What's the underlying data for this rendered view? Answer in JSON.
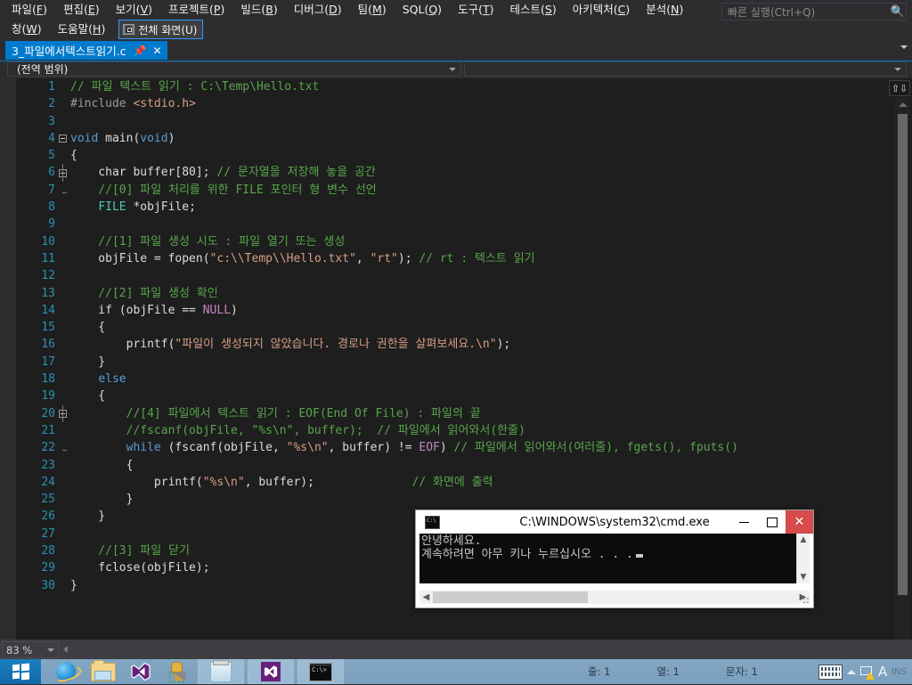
{
  "menu": {
    "row1": [
      {
        "label": "파일(F)",
        "mnemonic": "F"
      },
      {
        "label": "편집(E)",
        "mnemonic": "E"
      },
      {
        "label": "보기(V)",
        "mnemonic": "V"
      },
      {
        "label": "프로젝트(P)",
        "mnemonic": "P"
      },
      {
        "label": "빌드(B)",
        "mnemonic": "B"
      },
      {
        "label": "디버그(D)",
        "mnemonic": "D"
      },
      {
        "label": "팀(M)",
        "mnemonic": "M"
      },
      {
        "label": "SQL(Q)",
        "mnemonic": "Q"
      },
      {
        "label": "도구(T)",
        "mnemonic": "T"
      },
      {
        "label": "테스트(S)",
        "mnemonic": "S"
      },
      {
        "label": "아키텍처(C)",
        "mnemonic": "C"
      },
      {
        "label": "분석(N)",
        "mnemonic": "N"
      }
    ],
    "row2": [
      {
        "label": "창(W)",
        "mnemonic": "W"
      },
      {
        "label": "도움말(H)",
        "mnemonic": "H"
      }
    ],
    "fullscreen_button": {
      "label": "전체 화면(U)",
      "icon": "fullscreen-icon"
    }
  },
  "quick_launch": {
    "placeholder": "빠른 실행(Ctrl+Q)",
    "value": "",
    "icon": "search-icon"
  },
  "tab": {
    "title": "3_파일에서텍스트읽기.c",
    "pin_icon": "pin-icon",
    "close_icon": "close-icon",
    "overflow_icon": "chevron-down-icon"
  },
  "scope": {
    "left": "(전역 범위)",
    "right": ""
  },
  "editor": {
    "zoom": "83 %",
    "lines": [
      {
        "n": "1",
        "fold": "",
        "bar": "",
        "segs": [
          {
            "t": "// 파일 텍스트 읽기 : C:\\Temp\\Hello.txt",
            "c": "cmt"
          }
        ]
      },
      {
        "n": "2",
        "fold": "",
        "bar": "",
        "segs": [
          {
            "t": "#include ",
            "c": "pp"
          },
          {
            "t": "<stdio.h>",
            "c": "inc"
          }
        ]
      },
      {
        "n": "3",
        "fold": "",
        "bar": "",
        "segs": [
          {
            "t": "",
            "c": "code"
          }
        ]
      },
      {
        "n": "4",
        "fold": "box",
        "bar": "",
        "segs": [
          {
            "t": "void",
            "c": "kw"
          },
          {
            "t": " main(",
            "c": "code"
          },
          {
            "t": "void",
            "c": "kw"
          },
          {
            "t": ")",
            "c": "code"
          }
        ]
      },
      {
        "n": "5",
        "fold": "",
        "bar": "full",
        "segs": [
          {
            "t": "{",
            "c": "code"
          }
        ]
      },
      {
        "n": "6",
        "fold": "box",
        "bar": "full",
        "segs": [
          {
            "t": "    char buffer[80]; ",
            "c": "code"
          },
          {
            "t": "// 문자열을 저장해 놓을 공간",
            "c": "cmt"
          }
        ]
      },
      {
        "n": "7",
        "fold": "",
        "bar": "tick",
        "segs": [
          {
            "t": "    //[0] 파일 처리를 위한 FILE 포인터 형 변수 선언",
            "c": "cmt"
          }
        ]
      },
      {
        "n": "8",
        "fold": "",
        "bar": "full",
        "segs": [
          {
            "t": "    ",
            "c": "code"
          },
          {
            "t": "FILE",
            "c": "type"
          },
          {
            "t": " *objFile;",
            "c": "code"
          }
        ]
      },
      {
        "n": "9",
        "fold": "",
        "bar": "full",
        "segs": [
          {
            "t": "",
            "c": "code"
          }
        ]
      },
      {
        "n": "10",
        "fold": "",
        "bar": "full",
        "segs": [
          {
            "t": "    //[1] 파일 생성 시도 : 파일 열기 또는 생성",
            "c": "cmt"
          }
        ]
      },
      {
        "n": "11",
        "fold": "",
        "bar": "full",
        "segs": [
          {
            "t": "    objFile = fopen(",
            "c": "code"
          },
          {
            "t": "\"c:\\\\Temp\\\\Hello.txt\"",
            "c": "str"
          },
          {
            "t": ", ",
            "c": "code"
          },
          {
            "t": "\"rt\"",
            "c": "str"
          },
          {
            "t": "); ",
            "c": "code"
          },
          {
            "t": "// rt : 텍스트 읽기",
            "c": "cmt"
          }
        ]
      },
      {
        "n": "12",
        "fold": "",
        "bar": "full",
        "segs": [
          {
            "t": "",
            "c": "code"
          }
        ]
      },
      {
        "n": "13",
        "fold": "",
        "bar": "full",
        "segs": [
          {
            "t": "    //[2] 파일 생성 확인",
            "c": "cmt"
          }
        ]
      },
      {
        "n": "14",
        "fold": "",
        "bar": "full",
        "segs": [
          {
            "t": "    if (objFile == ",
            "c": "code"
          },
          {
            "t": "NULL",
            "c": "mac"
          },
          {
            "t": ")",
            "c": "code"
          }
        ]
      },
      {
        "n": "15",
        "fold": "",
        "bar": "full",
        "segs": [
          {
            "t": "    {",
            "c": "code"
          }
        ]
      },
      {
        "n": "16",
        "fold": "",
        "bar": "full",
        "segs": [
          {
            "t": "        printf(",
            "c": "code"
          },
          {
            "t": "\"파일이 생성되지 않았습니다. 경로나 권한을 살펴보세요.\\n\"",
            "c": "str"
          },
          {
            "t": ");",
            "c": "code"
          }
        ]
      },
      {
        "n": "17",
        "fold": "",
        "bar": "full",
        "segs": [
          {
            "t": "    }",
            "c": "code"
          }
        ]
      },
      {
        "n": "18",
        "fold": "",
        "bar": "full",
        "segs": [
          {
            "t": "    ",
            "c": "code"
          },
          {
            "t": "else",
            "c": "kw"
          }
        ]
      },
      {
        "n": "19",
        "fold": "",
        "bar": "full",
        "segs": [
          {
            "t": "    {",
            "c": "code"
          }
        ]
      },
      {
        "n": "20",
        "fold": "box",
        "bar": "full",
        "segs": [
          {
            "t": "        //[4] 파일에서 텍스트 읽기 : EOF(End Of File) : 파일의 끝",
            "c": "cmt"
          }
        ]
      },
      {
        "n": "21",
        "fold": "",
        "bar": "full",
        "segs": [
          {
            "t": "        //fscanf(objFile, \"%s\\n\", buffer);  // 파일에서 읽어와서(한줄)",
            "c": "cmt"
          }
        ]
      },
      {
        "n": "22",
        "fold": "",
        "bar": "tick",
        "segs": [
          {
            "t": "        ",
            "c": "code"
          },
          {
            "t": "while",
            "c": "kw"
          },
          {
            "t": " (fscanf(objFile, ",
            "c": "code"
          },
          {
            "t": "\"%s\\n\"",
            "c": "str"
          },
          {
            "t": ", buffer) != ",
            "c": "code"
          },
          {
            "t": "EOF",
            "c": "mac"
          },
          {
            "t": ") ",
            "c": "code"
          },
          {
            "t": "// 파일에서 읽어와서(여러줄), fgets(), fputs()",
            "c": "cmt"
          }
        ]
      },
      {
        "n": "23",
        "fold": "",
        "bar": "full",
        "segs": [
          {
            "t": "        {",
            "c": "code"
          }
        ]
      },
      {
        "n": "24",
        "fold": "",
        "bar": "full",
        "segs": [
          {
            "t": "            printf(",
            "c": "code"
          },
          {
            "t": "\"%s\\n\"",
            "c": "str"
          },
          {
            "t": ", buffer);              ",
            "c": "code"
          },
          {
            "t": "// 화면에 출력",
            "c": "cmt"
          }
        ]
      },
      {
        "n": "25",
        "fold": "",
        "bar": "full",
        "segs": [
          {
            "t": "        }",
            "c": "code"
          }
        ]
      },
      {
        "n": "26",
        "fold": "",
        "bar": "full",
        "segs": [
          {
            "t": "    }",
            "c": "code"
          }
        ]
      },
      {
        "n": "27",
        "fold": "",
        "bar": "full",
        "segs": [
          {
            "t": "",
            "c": "code"
          }
        ]
      },
      {
        "n": "28",
        "fold": "",
        "bar": "full",
        "segs": [
          {
            "t": "    //[3] 파일 닫기",
            "c": "cmt"
          }
        ]
      },
      {
        "n": "29",
        "fold": "",
        "bar": "full",
        "segs": [
          {
            "t": "    fclose(objFile);",
            "c": "code"
          }
        ]
      },
      {
        "n": "30",
        "fold": "",
        "bar": "full",
        "segs": [
          {
            "t": "}",
            "c": "code"
          }
        ]
      }
    ]
  },
  "status": {
    "line_label": "줄: 1",
    "col_label": "열: 1",
    "char_label": "문자: 1",
    "insert_mode": "INS"
  },
  "cmd_window": {
    "title": "C:\\WINDOWS\\system32\\cmd.exe",
    "icon": "console-icon",
    "minimize": "−",
    "maximize": "□",
    "close": "✕",
    "output_line1": "안녕하세요.",
    "output_line2": "계속하려면 아무 키나 누르십시오 . . ."
  },
  "taskbar": {
    "start": "start-button",
    "quick": [
      {
        "name": "internet-explorer-icon"
      },
      {
        "name": "file-explorer-icon"
      },
      {
        "name": "visual-studio-icon"
      },
      {
        "name": "sql-server-tools-icon"
      }
    ],
    "running": [
      {
        "name": "notepad-window-button"
      },
      {
        "name": "visual-studio-window-button"
      },
      {
        "name": "command-prompt-window-button"
      }
    ],
    "tray": [
      {
        "name": "touch-keyboard-icon"
      },
      {
        "name": "show-hidden-icons-icon"
      },
      {
        "name": "network-warning-icon"
      },
      {
        "name": "ime-korean-icon"
      }
    ]
  },
  "colors": {
    "accent": "#007acc",
    "editor_bg": "#1e1e1e",
    "chrome_bg": "#2d2d30",
    "comment": "#57a64a",
    "keyword": "#569cd6",
    "string": "#d69d85",
    "macro": "#c586c0",
    "type": "#4ec9b0",
    "linenum": "#2b91af",
    "taskbar": "#79a0bf",
    "close_button": "#d64b4b"
  }
}
